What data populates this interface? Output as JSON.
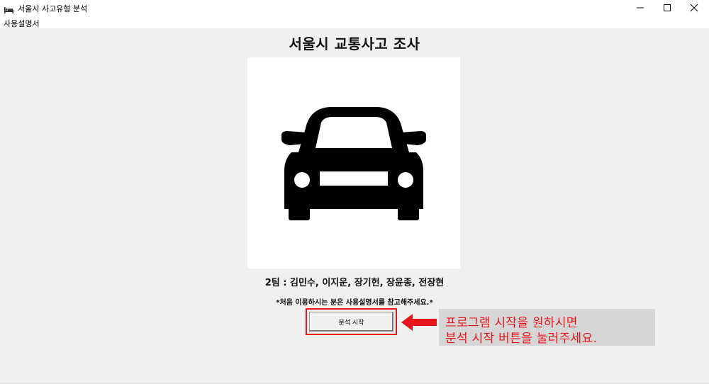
{
  "window": {
    "title": "서울시 사고유형 분석",
    "controls": {
      "minimize_icon": "minimize-icon",
      "maximize_icon": "maximize-icon",
      "close_icon": "close-icon"
    }
  },
  "menubar": {
    "items": [
      {
        "label": "사용설명서"
      }
    ]
  },
  "main": {
    "title": "서울시 교통사고 조사",
    "image_icon": "car-front-icon",
    "team_number": "2팀",
    "team_members": " : 김민수, 이지운, 장기헌, 장윤종, 전장현",
    "notice": "*처음 이용하시는 분은 사용설명서를 참고해주세요.*",
    "start_button_label": "분석 시작"
  },
  "annotation": {
    "line1": "프로그램 시작을 원하시면",
    "line2": "분석 시작 버튼을 눌러주세요.",
    "color": "#e8141b",
    "box_color": "#d6d6d6"
  }
}
